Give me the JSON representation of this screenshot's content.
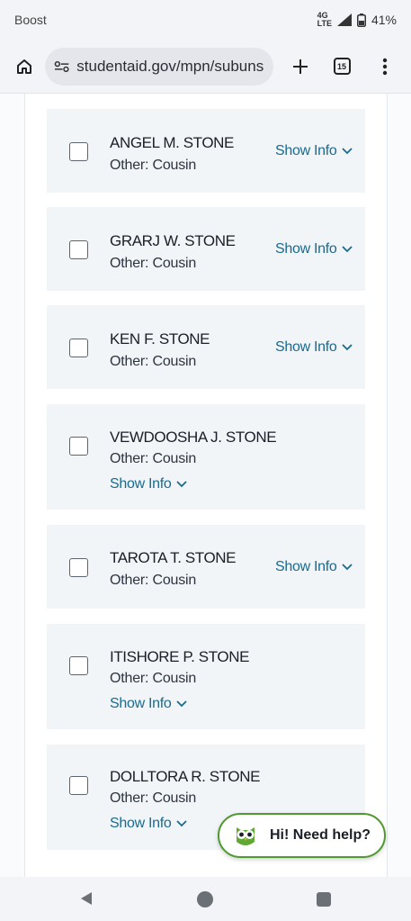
{
  "status_bar": {
    "carrier": "Boost",
    "network": "4G LTE",
    "battery": "41%"
  },
  "browser": {
    "url": "studentaid.gov/mpn/subunsu",
    "tab_count": "15"
  },
  "people": [
    {
      "name": "ANGEL M. STONE",
      "relation": "Other: Cousin",
      "show_info": "Show Info"
    },
    {
      "name": "GRARJ W. STONE",
      "relation": "Other: Cousin",
      "show_info": "Show Info"
    },
    {
      "name": "KEN F. STONE",
      "relation": "Other: Cousin",
      "show_info": "Show Info"
    },
    {
      "name": "VEWDOOSHA J. STONE",
      "relation": "Other: Cousin",
      "show_info": "Show Info"
    },
    {
      "name": "TAROTA T. STONE",
      "relation": "Other: Cousin",
      "show_info": "Show Info"
    },
    {
      "name": "ITISHORE P. STONE",
      "relation": "Other: Cousin",
      "show_info": "Show Info"
    },
    {
      "name": "DOLLTORA R. STONE",
      "relation": "Other: Cousin",
      "show_info": "Show Info"
    }
  ],
  "chat": {
    "label": "Hi! Need help?",
    "icon": "owl-icon"
  },
  "colors": {
    "link": "#1a6a8e",
    "card_bg": "#f1f5f8",
    "chat_border": "#4f9a2f"
  }
}
